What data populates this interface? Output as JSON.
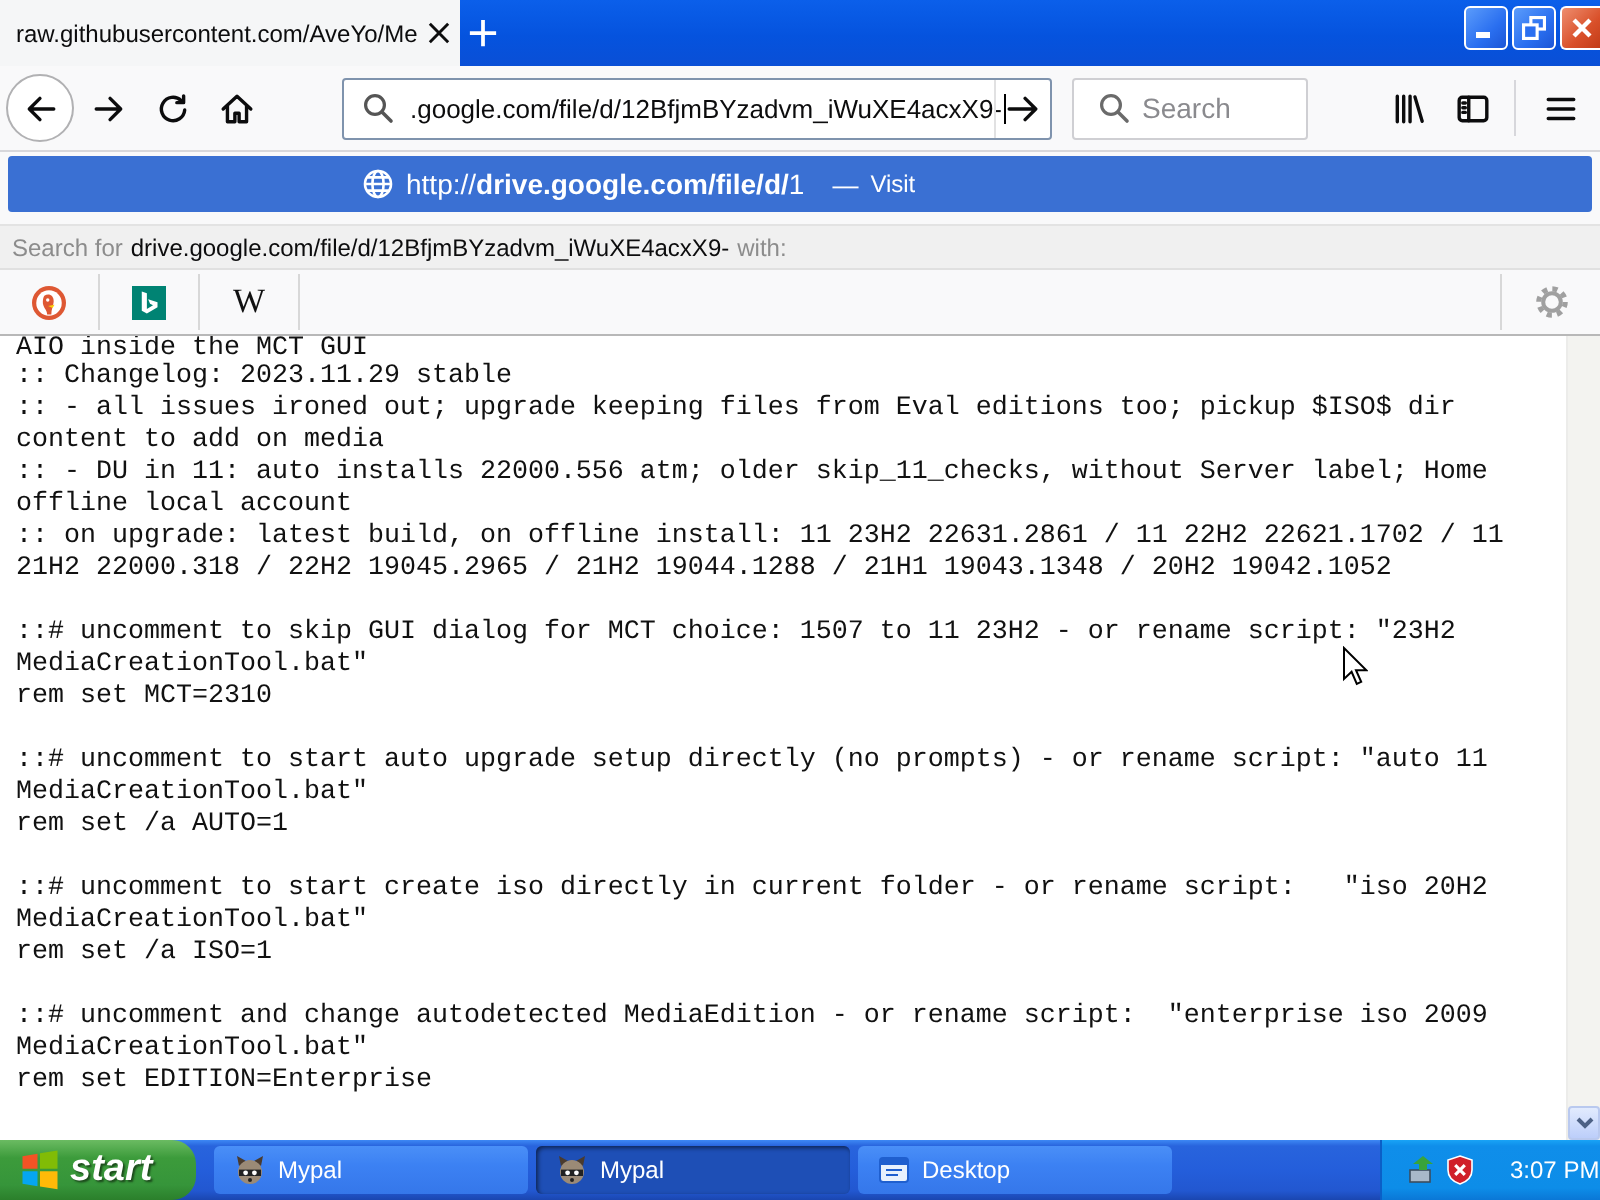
{
  "window": {
    "tabs": [
      {
        "title": "raw.githubusercontent.com/AveYo/Me",
        "selected": true
      }
    ]
  },
  "toolbar": {
    "address": {
      "value": ".google.com/file/d/12BfjmBYzadvm_iWuXE4acxX9-"
    },
    "search": {
      "placeholder": "Search"
    }
  },
  "url_popup": {
    "result": {
      "url": "http://**drive.google.com/file/d/**1",
      "separator": "—",
      "action": "Visit",
      "selected": true
    },
    "search_for": {
      "prefix": "Search for",
      "query": "drive.google.com/file/d/12BfjmBYzadvm_iWuXE4acxX9-",
      "suffix": "with:"
    },
    "engines": [
      {
        "kind": "duck"
      },
      {
        "kind": "tile"
      },
      {
        "kind": "letter",
        "label": "W"
      }
    ]
  },
  "page": {
    "blocks": [
      [
        "AIO inside the MCT GUI",
        ":: Changelog: 2023.11.29 stable",
        ":: - all issues ironed out; upgrade keeping files from Eval editions too; pickup $ISO$ dir",
        "content to add on media",
        ":: - DU in 11: auto installs 22000.556 atm; older skip_11_checks, without Server label; Home",
        "offline local account",
        ":: on upgrade: latest build, on offline install: 11 23H2 22631.2861 / 11 22H2 22621.1702 / 11",
        "21H2 22000.318 / 22H2 19045.2965 / 21H2 19044.1288 / 21H1 19043.1348 / 20H2 19042.1052"
      ],
      [
        "::# uncomment to skip GUI dialog for MCT choice: 1507 to 11 23H2 - or rename script: \"23H2",
        "MediaCreationTool.bat\"",
        "rem set MCT=2310"
      ],
      [
        "::# uncomment to start auto upgrade setup directly (no prompts) - or rename script: \"auto 11",
        "MediaCreationTool.bat\"",
        "rem set /a AUTO=1"
      ],
      [
        "::# uncomment to start create iso directly in current folder - or rename script:   \"iso 20H2",
        "MediaCreationTool.bat\"",
        "rem set /a ISO=1"
      ],
      [
        "::# uncomment and change autodetected MediaEdition - or rename script:  \"enterprise iso 2009",
        "MediaCreationTool.bat\"",
        "rem set EDITION=Enterprise"
      ]
    ]
  },
  "taskbar": {
    "start": "start",
    "tasks": [
      {
        "label": "Mypal",
        "kind": "app",
        "selected": false
      },
      {
        "label": "Mypal",
        "kind": "app",
        "selected": true
      },
      {
        "label": "Desktop",
        "kind": "desktop",
        "selected": false
      }
    ],
    "clock": "3:07 PM"
  }
}
